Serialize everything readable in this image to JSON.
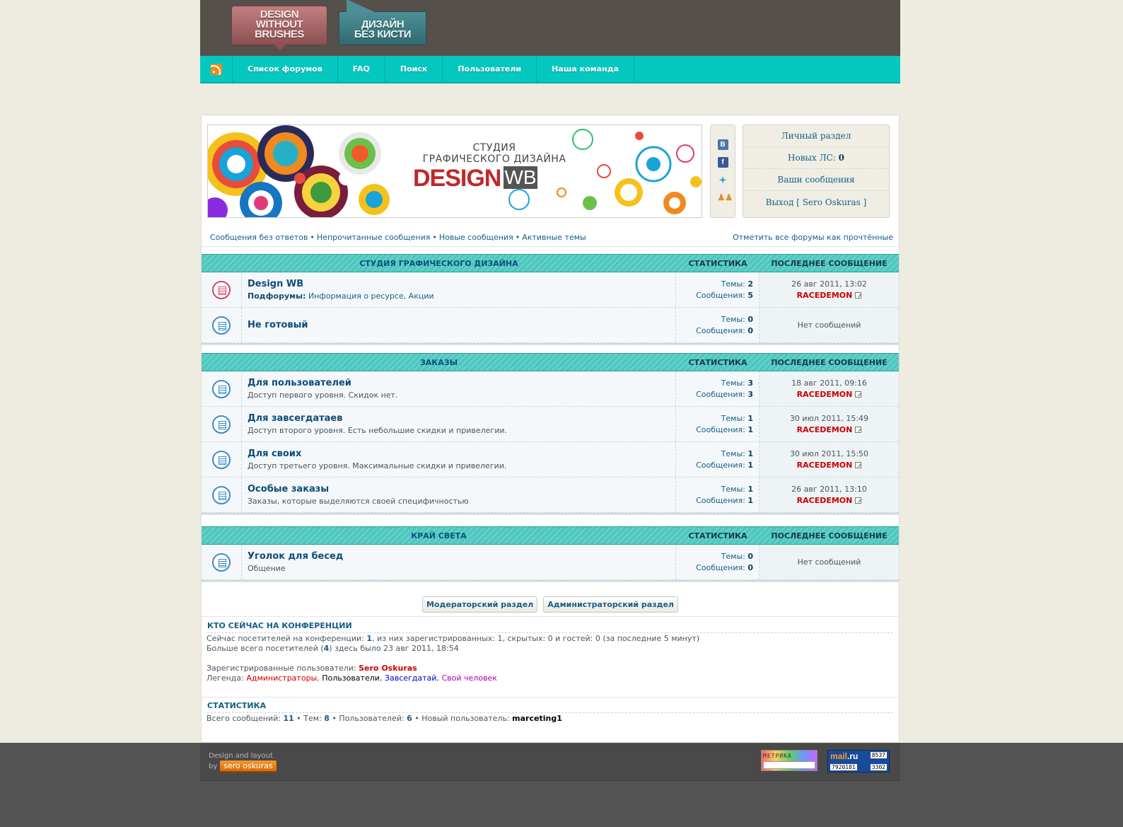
{
  "logo": {
    "en_lines": [
      "DESIGN",
      "WITHOUT",
      "BRUSHES"
    ],
    "ru_lines": [
      "ДИЗАЙН",
      "БЕЗ КИСТИ"
    ]
  },
  "nav": {
    "items": [
      "Список форумов",
      "FAQ",
      "Поиск",
      "Пользователи",
      "Наша команда"
    ]
  },
  "banner": {
    "subtitle_line1": "СТУДИЯ",
    "subtitle_line2": "ГРАФИЧЕСКОГО ДИЗАЙНА",
    "title": "DESIGN",
    "title_box": "WB"
  },
  "user_box": {
    "personal": "Личный раздел",
    "new_pm_label": "Новых ЛС:",
    "new_pm_count": "0",
    "your_posts": "Ваши сообщения",
    "logout": "Выход [ Sero Oskuras ]"
  },
  "quick_links": {
    "unanswered": "Сообщения без ответов",
    "unread": "Непрочитанные сообщения",
    "new_posts": "Новые сообщения",
    "active": "Активные темы",
    "mark_read": "Отметить все форумы как прочтённые"
  },
  "labels": {
    "stats": "СТАТИСТИКА",
    "last_post": "ПОСЛЕДНЕЕ СООБЩЕНИЕ",
    "topics": "Темы:",
    "posts": "Сообщения:",
    "no_posts": "Нет сообщений",
    "subforums": "Подфорумы:"
  },
  "categories": [
    {
      "name": "СТУДИЯ ГРАФИЧЕСКОГО ДИЗАЙНА",
      "forums": [
        {
          "title": "Design WB",
          "desc": "",
          "subforums": [
            "Информация о ресурсе",
            "Акции"
          ],
          "topics": "2",
          "posts": "5",
          "last_date": "26 авг 2011, 13:02",
          "last_author": "RACEDEMON",
          "unread": true
        },
        {
          "title": "Не готовый",
          "desc": "",
          "subforums": [],
          "topics": "0",
          "posts": "0",
          "last_date": "",
          "last_author": "",
          "unread": false
        }
      ]
    },
    {
      "name": "ЗАКАЗЫ",
      "forums": [
        {
          "title": "Для пользователей",
          "desc": "Доступ первого уровня. Скидок нет.",
          "subforums": [],
          "topics": "3",
          "posts": "3",
          "last_date": "18 авг 2011, 09:16",
          "last_author": "RACEDEMON",
          "unread": false
        },
        {
          "title": "Для завсегдатаев",
          "desc": "Доступ второго уровня. Есть небольшие скидки и привелегии.",
          "subforums": [],
          "topics": "1",
          "posts": "1",
          "last_date": "30 июл 2011, 15:49",
          "last_author": "RACEDEMON",
          "unread": false
        },
        {
          "title": "Для своих",
          "desc": "Доступ третьего уровня. Максимальные скидки и привелегии.",
          "subforums": [],
          "topics": "1",
          "posts": "1",
          "last_date": "30 июл 2011, 15:50",
          "last_author": "RACEDEMON",
          "unread": false
        },
        {
          "title": "Особые заказы",
          "desc": "Заказы, которые выделяются своей специфичностью",
          "subforums": [],
          "topics": "1",
          "posts": "1",
          "last_date": "26 авг 2011, 13:10",
          "last_author": "RACEDEMON",
          "unread": false
        }
      ]
    },
    {
      "name": "КРАЙ СВЕТА",
      "forums": [
        {
          "title": "Уголок для бесед",
          "desc": "Общение",
          "subforums": [],
          "topics": "0",
          "posts": "0",
          "last_date": "",
          "last_author": "",
          "unread": false
        }
      ]
    }
  ],
  "buttons": {
    "moderator": "Модераторский раздел",
    "admin": "Администраторский раздел"
  },
  "online": {
    "title": "КТО СЕЙЧАС НА КОНФЕРЕНЦИИ",
    "line1_pre": "Сейчас посетителей на конференции: ",
    "line1_count": "1",
    "line1_post": ", из них зарегистрированных: 1, скрытых: 0 и гостей: 0 (за последние 5 минут)",
    "line2_pre": "Больше всего посетителей (",
    "line2_count": "4",
    "line2_post": ") здесь было 23 авг 2011, 18:54",
    "registered_label": "Зарегистрированные пользователи: ",
    "registered_user": "Sero Oskuras",
    "legend_label": "Легенда: ",
    "legend": [
      "Администраторы",
      "Пользователи",
      "Завсегдатай",
      "Свой человек"
    ]
  },
  "statistics": {
    "title": "СТАТИСТИКА",
    "total_posts_label": "Всего сообщений: ",
    "total_posts": "11",
    "topics_label": "Тем: ",
    "topics": "8",
    "users_label": "Пользователей: ",
    "users": "6",
    "newest_label": "Новый пользователь: ",
    "newest": "marceting1"
  },
  "footer": {
    "credit_line1": "Design and layout",
    "credit_by": "by",
    "author": "sero oskuras",
    "metrika_label": "МЕТРИКА",
    "mail_logo": "mail",
    "mail_logo_tld": ".ru",
    "mail_total": "7920181",
    "mail_n1": "8537",
    "mail_n2": "3302"
  },
  "colors": {
    "background": "#eeece0",
    "nav": "#04c8c0",
    "header": "#55504a",
    "footer": "#4a4949",
    "link": "#155e86",
    "author": "#cc0000"
  }
}
